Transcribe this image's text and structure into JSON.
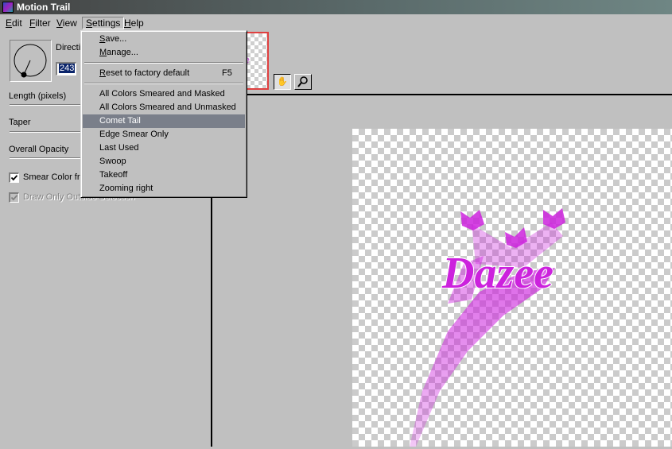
{
  "window": {
    "title": "Motion Trail"
  },
  "menubar": {
    "items": [
      {
        "label": "Edit",
        "key": "E",
        "rest": "dit"
      },
      {
        "label": "Filter",
        "key": "F",
        "rest": "ilter"
      },
      {
        "label": "View",
        "key": "V",
        "rest": "iew"
      },
      {
        "label": "Settings",
        "key": "S",
        "rest": "ettings"
      },
      {
        "label": "Help",
        "key": "H",
        "rest": "elp"
      }
    ]
  },
  "controls": {
    "direction_label": "Directi",
    "direction_value": "243",
    "length_label": "Length (pixels)",
    "taper_label": "Taper",
    "opacity_label": "Overall Opacity",
    "smear_color_label": "Smear Color fro",
    "smear_color_checked": true,
    "draw_outside_label": "Draw Only Outside Selection",
    "draw_outside_checked": true
  },
  "settings_menu": {
    "items": [
      {
        "label": "Save...",
        "key": "S",
        "rest": "ave..."
      },
      {
        "label": "Manage...",
        "key": "M",
        "rest": "anage..."
      },
      {
        "label": "Reset to factory default",
        "key": "R",
        "rest": "eset to factory default",
        "shortcut": "F5"
      },
      {
        "label": "All Colors Smeared and Masked"
      },
      {
        "label": "All Colors Smeared and Unmasked"
      },
      {
        "label": "Comet Tail",
        "highlighted": true
      },
      {
        "label": "Edge Smear Only"
      },
      {
        "label": "Last Used"
      },
      {
        "label": "Swoop"
      },
      {
        "label": "Takeoff"
      },
      {
        "label": "Zooming right"
      }
    ]
  },
  "preview": {
    "text": "Dazee",
    "color": "#cc22dd"
  },
  "icons": {
    "pan": "hand-icon",
    "zoom": "magnifier-icon"
  }
}
